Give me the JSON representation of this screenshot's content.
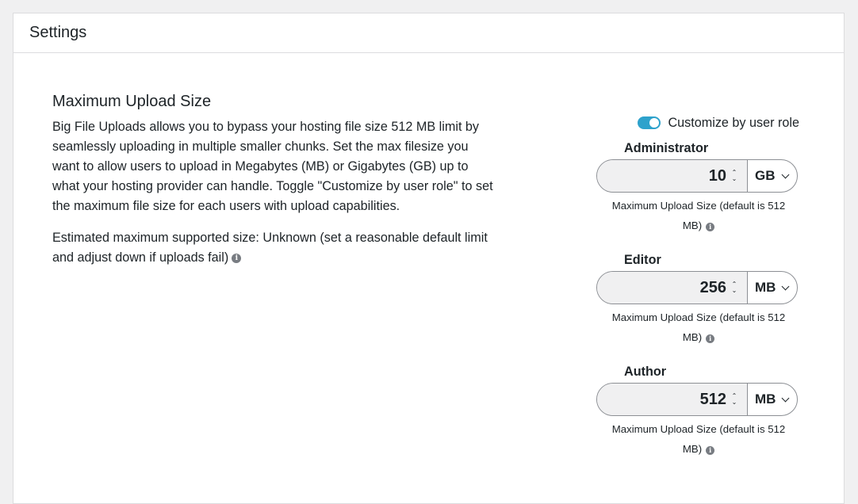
{
  "header": {
    "title": "Settings"
  },
  "upload": {
    "title": "Maximum Upload Size",
    "description": "Big File Uploads allows you to bypass your hosting file size 512 MB limit by seamlessly uploading in multiple smaller chunks. Set the max filesize you want to allow users to upload in Megabytes (MB) or Gigabytes (GB) up to what your hosting provider can handle. Toggle \"Customize by user role\" to set the maximum file size for each users with upload capabilities.",
    "estimate": "Estimated maximum supported size: Unknown (set a reasonable default limit and adjust down if uploads fail)"
  },
  "toggle": {
    "label": "Customize by user role",
    "on": true,
    "color": "#2ea2cc"
  },
  "roles": [
    {
      "label": "Administrator",
      "value": "10",
      "unit": "GB",
      "help_line1": "Maximum Upload Size (default is 512",
      "help_line2": "MB)"
    },
    {
      "label": "Editor",
      "value": "256",
      "unit": "MB",
      "help_line1": "Maximum Upload Size (default is 512",
      "help_line2": "MB)"
    },
    {
      "label": "Author",
      "value": "512",
      "unit": "MB",
      "help_line1": "Maximum Upload Size (default is 512",
      "help_line2": "MB)"
    }
  ],
  "icons": {
    "info": "info-icon",
    "spinner_up": "⌃",
    "spinner_down": "⌄"
  }
}
